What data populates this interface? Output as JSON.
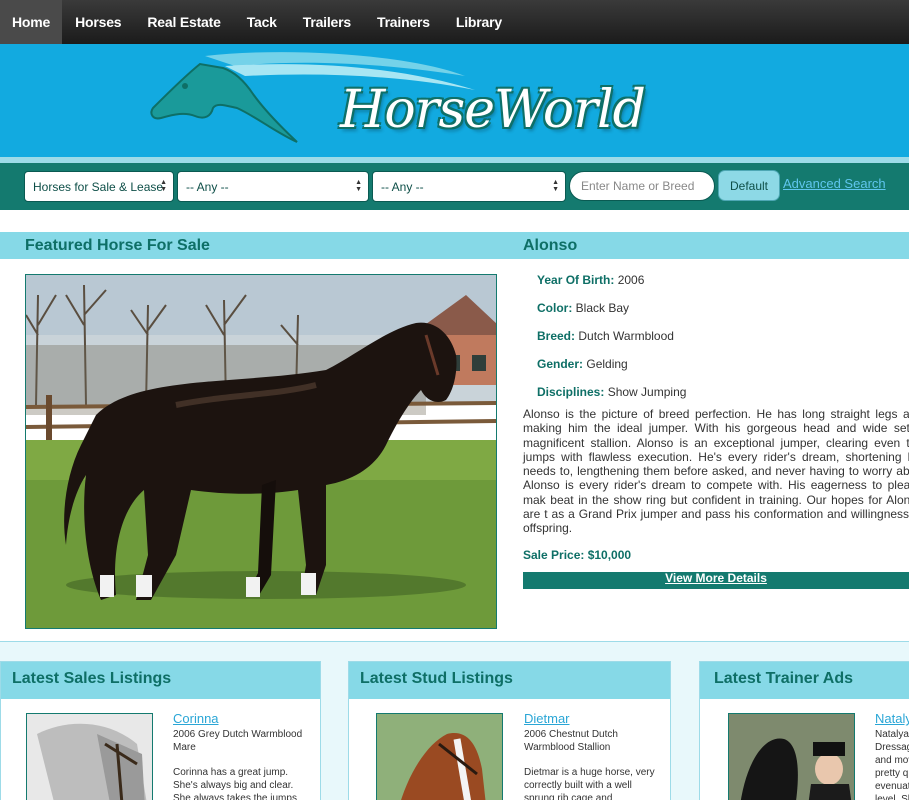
{
  "nav": {
    "items": [
      {
        "label": "Home",
        "active": true
      },
      {
        "label": "Horses"
      },
      {
        "label": "Real Estate"
      },
      {
        "label": "Tack"
      },
      {
        "label": "Trailers"
      },
      {
        "label": "Trainers"
      },
      {
        "label": "Library"
      }
    ]
  },
  "brand": {
    "logo_text": "HorseWorld"
  },
  "search": {
    "category": "Horses for Sale & Lease",
    "filter1": "-- Any --",
    "filter2": "-- Any --",
    "name_placeholder": "Enter Name or Breed",
    "default_button": "Default",
    "advanced_link": "Advanced Search"
  },
  "featured": {
    "section_title": "Featured Horse For Sale",
    "name": "Alonso",
    "details": [
      {
        "label": "Year Of Birth:",
        "value": "2006"
      },
      {
        "label": "Color:",
        "value": "Black Bay"
      },
      {
        "label": "Breed:",
        "value": "Dutch Warmblood"
      },
      {
        "label": "Gender:",
        "value": "Gelding"
      },
      {
        "label": "Disciplines:",
        "value": "Show Jumping"
      }
    ],
    "description": "Alonso is the picture of breed perfection. He has long straight legs and making him the ideal jumper. With his gorgeous head and wide set e magnificent stallion. Alonso is an exceptional jumper, clearing even the jumps with flawless execution. He's every rider's dream, shortening his needs to, lengthening them before asked, and never having to worry abou Alonso is every rider's dream to compete with. His eagerness to please mak beat in the show ring but confident in training. Our hopes for Alonso are t as a Grand Prix jumper and pass his conformation and willingness to offspring.",
    "price": "Sale Price: $10,000",
    "view_more": "View More Details"
  },
  "cards": [
    {
      "title": "Latest Sales Listings",
      "name": "Corinna",
      "sub": "2006 Grey Dutch Warmblood Mare",
      "desc": "Corinna has a great jump. She's always big and clear. She always takes the jumps"
    },
    {
      "title": "Latest Stud Listings",
      "name": "Dietmar",
      "sub": "2006 Chestnut Dutch Warmblood Stallion",
      "desc": "Dietmar is a huge horse, very correctly built with a well sprung rib cage and"
    },
    {
      "title": "Latest Trainer Ads",
      "name": "Natalya",
      "sub": "Natalya Dressag and mov pretty qu evenuat level. Sh",
      "desc": ""
    }
  ],
  "colors": {
    "nav_bg": "#1b1b1b",
    "banner_bg": "#12aae0",
    "brand_teal": "#147a6f",
    "section_head": "#86d9e7",
    "link_blue": "#2aa6d6"
  }
}
